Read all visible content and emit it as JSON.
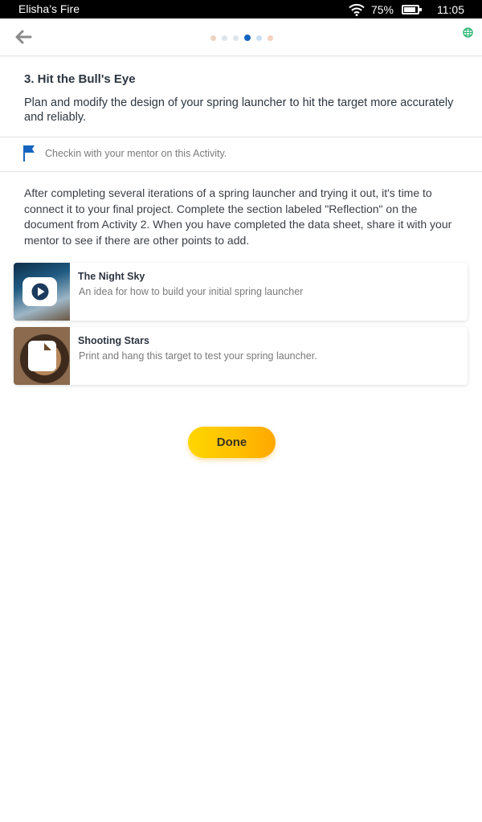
{
  "status_bar": {
    "device_name": "Elisha’s Fire",
    "battery_percent": "75%",
    "battery_level": 0.75,
    "time": "11:05",
    "wifi_icon": "wifi-icon",
    "battery_icon": "battery-icon"
  },
  "header": {
    "back_icon": "back-arrow-icon",
    "pager": {
      "total": 6,
      "current": 4
    },
    "globe_icon": "globe-icon"
  },
  "activity": {
    "title": "3. Hit the Bull's Eye",
    "description": "Plan and modify the design of your spring launcher to hit the target more accurately and reliably."
  },
  "checkin": {
    "icon": "flag-icon",
    "text": "Checkin with your mentor on this Activity."
  },
  "instructions": "After completing several iterations of a spring launcher and trying it out, it's time to connect it to your final project. Complete the section labeled \"Reflection\" on the document from Activity 2. When you have completed the data sheet, share it with your mentor to see if there are other points to add.",
  "resources": [
    {
      "title": "The Night Sky",
      "subtitle": "An idea for how to build your initial spring launcher",
      "type_icon": "play-icon"
    },
    {
      "title": "Shooting Stars",
      "subtitle": "Print and hang this target to test your spring launcher.",
      "type_icon": "document-icon"
    }
  ],
  "done_button": {
    "label": "Done"
  },
  "colors": {
    "accent_blue": "#1565c0",
    "done_gradient_start": "#ffd600",
    "done_gradient_end": "#ffa800",
    "globe_green": "#2bb673"
  }
}
